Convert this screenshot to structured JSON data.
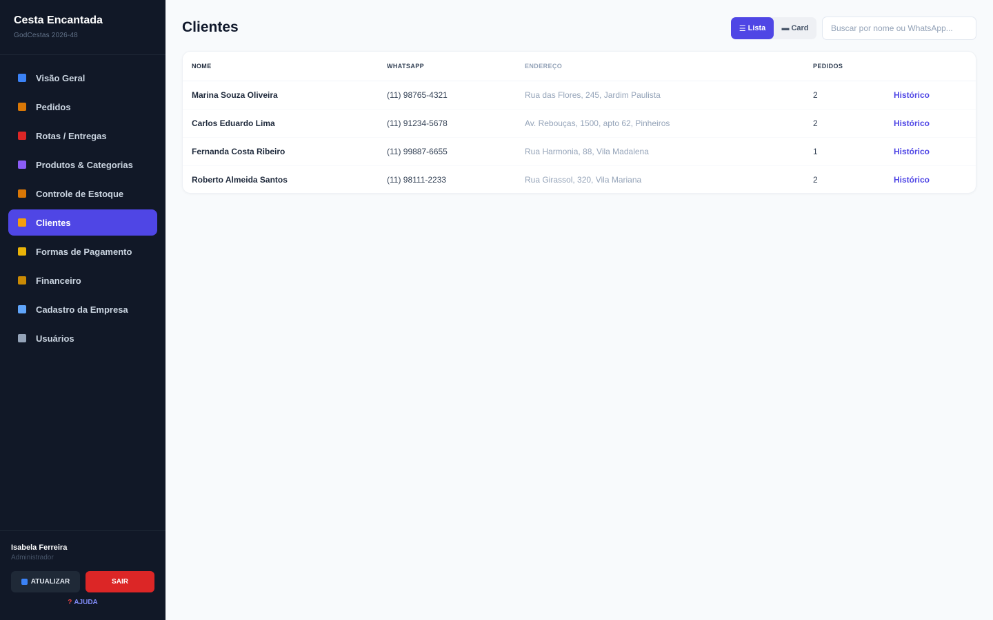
{
  "sidebar": {
    "brand_title": "Cesta Encantada",
    "brand_sub": "GodCestas 2026-48",
    "items": [
      {
        "label": "Visão Geral",
        "icon": "chart-icon",
        "color": "#3b82f6"
      },
      {
        "label": "Pedidos",
        "icon": "package-icon",
        "color": "#d97706"
      },
      {
        "label": "Rotas / Entregas",
        "icon": "truck-icon",
        "color": "#dc2626"
      },
      {
        "label": "Produtos & Categorias",
        "icon": "shopping-icon",
        "color": "#8b5cf6"
      },
      {
        "label": "Controle de Estoque",
        "icon": "box-icon",
        "color": "#d97706"
      },
      {
        "label": "Clientes",
        "icon": "people-icon",
        "color": "#f59e0b"
      },
      {
        "label": "Formas de Pagamento",
        "icon": "card-icon",
        "color": "#eab308"
      },
      {
        "label": "Financeiro",
        "icon": "money-bag-icon",
        "color": "#ca8a04"
      },
      {
        "label": "Cadastro da Empresa",
        "icon": "building-icon",
        "color": "#60a5fa"
      },
      {
        "label": "Usuários",
        "icon": "user-icon",
        "color": "#94a3b8"
      }
    ],
    "active_index": 5,
    "user_name": "Isabela Ferreira",
    "user_role": "Administrador",
    "refresh_label": "ATUALIZAR",
    "exit_label": "SAIR",
    "help_label": "AJUDA",
    "help_glyph": "?"
  },
  "main": {
    "title": "Clientes",
    "toggle": {
      "list_label": "Lista",
      "card_label": "Card",
      "active": "Lista"
    },
    "search_placeholder": "Buscar por nome ou WhatsApp...",
    "table": {
      "headers": [
        "NOME",
        "WHATSAPP",
        "ENDEREÇO",
        "PEDIDOS",
        ""
      ],
      "rows": [
        {
          "name": "Marina Souza Oliveira",
          "whatsapp": "(11) 98765-4321",
          "address": "Rua das Flores, 245, Jardim Paulista",
          "orders": "2",
          "action": "Histórico"
        },
        {
          "name": "Carlos Eduardo Lima",
          "whatsapp": "(11) 91234-5678",
          "address": "Av. Rebouças, 1500, apto 62, Pinheiros",
          "orders": "2",
          "action": "Histórico"
        },
        {
          "name": "Fernanda Costa Ribeiro",
          "whatsapp": "(11) 99887-6655",
          "address": "Rua Harmonia, 88, Vila Madalena",
          "orders": "1",
          "action": "Histórico"
        },
        {
          "name": "Roberto Almeida Santos",
          "whatsapp": "(11) 98111-2233",
          "address": "Rua Girassol, 320, Vila Mariana",
          "orders": "2",
          "action": "Histórico"
        }
      ]
    }
  },
  "colors": {
    "sidebar_bg": "#111827",
    "accent": "#4f46e5",
    "danger": "#dc2626",
    "page_bg": "#f8fafc"
  }
}
